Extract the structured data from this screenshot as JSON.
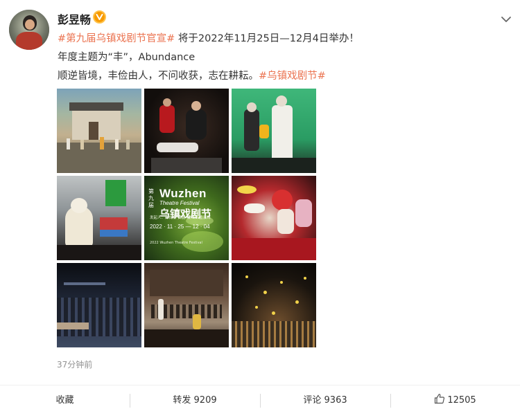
{
  "author": {
    "name": "彭昱畅"
  },
  "post": {
    "line1_tag": "#第九届乌镇戏剧节官宣#",
    "line1_text": " 将于2022年11月25日—12月4日举办！",
    "line2": "年度主题为“丰”，Abundance",
    "line3_text": "顺逆皆境，丰俭由人，不问收获，志在耕耘。",
    "line3_tag": "#乌镇戏剧节#",
    "timestamp": "37分钟前"
  },
  "poster": {
    "title": "Wuzhen",
    "subtitle": "Theatre Festival",
    "title_cn": "乌镇戏剧节",
    "side_cn": "第九届",
    "hosts": "发起人：陈向宏 黄磊 赖声川 孟京辉",
    "date": "2022 · 11 · 25 — 12 · 04",
    "footer": "2022 Wuzhen Theatre Festival"
  },
  "actions": {
    "favorite_label": "收藏",
    "repost_label": "转发",
    "repost_count": "9209",
    "comment_label": "评论",
    "comment_count": "9363",
    "like_count": "12505"
  },
  "colors": {
    "hashtag": "#eb7350",
    "verified_badge": "#f79a00",
    "timestamp": "#939393"
  },
  "icons": {
    "verified": "verified-badge-icon",
    "menu": "chevron-down-icon",
    "like": "thumbs-up-icon"
  }
}
